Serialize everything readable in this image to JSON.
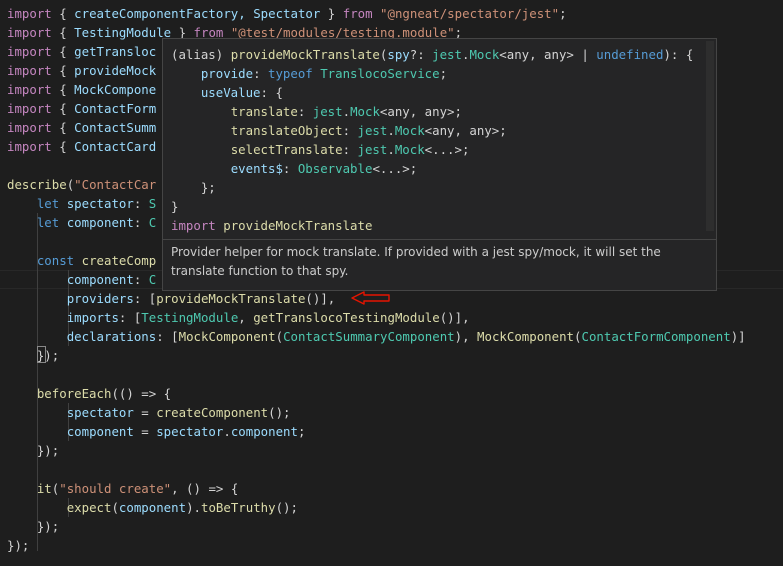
{
  "code": {
    "imports": [
      {
        "name": "createComponentFactory, Spectator",
        "module": "\"@ngneat/spectator/jest\""
      },
      {
        "name": "TestingModule",
        "module": "\"@test/modules/testing.module\""
      },
      {
        "name": "getTransloc",
        "module": ""
      },
      {
        "name": "provideMock",
        "module": ""
      },
      {
        "name": "MockCompone",
        "module": ""
      },
      {
        "name": "ContactForm",
        "module": ""
      },
      {
        "name": "ContactSumm",
        "module": ""
      },
      {
        "name": "ContactCard",
        "module": ""
      }
    ],
    "kw_import": "import",
    "kw_from": "from",
    "brace_open": "{ ",
    "brace_close": " }",
    "semi": ";",
    "describe_fn": "describe",
    "describe_str": "\"ContactCar",
    "let_kw": "let",
    "const_kw": "const",
    "spectator_var": "spectator",
    "spectator_type": "S",
    "component_var": "component",
    "component_type": "C",
    "create_var": "createComp",
    "component_key": "component",
    "component_val": "C",
    "providers_line": {
      "key": "providers",
      "open": ": [",
      "fn": "provideMockTranslate",
      "close": "()],"
    },
    "imports_line": {
      "key": "imports",
      "open": ": [",
      "mod": "TestingModule",
      "comma": ", ",
      "fn": "getTranslocoTestingModule",
      "close": "()],"
    },
    "declarations_line": {
      "key": "declarations",
      "open": ": [",
      "mc1": "MockComponent",
      "t1": "ContactSummaryComponent",
      "mid": "), ",
      "mc2": "MockComponent",
      "t2": "ContactFormComponent",
      "close": ")]"
    },
    "close_paren": "});",
    "before_each": "beforeEach",
    "arrow_open": "(() => {",
    "assign1_lhs": "spectator",
    "assign1_rhs": "createComponent",
    "assign2_lhs": "component",
    "assign2_obj": "spectator",
    "assign2_prop": "component",
    "close_brace": "});",
    "it_fn": "it",
    "it_str": "\"should create\"",
    "it_rest": ", () => {",
    "expect_fn": "expect",
    "expect_arg": "component",
    "to_be": "toBeTruthy",
    "final_close": "});"
  },
  "hover": {
    "sig_alias": "(alias) ",
    "sig_fn": "provideMockTranslate",
    "sig_param": "spy",
    "sig_opt": "?: ",
    "sig_jest": "jest",
    "sig_mock": "Mock",
    "sig_any": "<any, any>",
    "sig_pipe": " | ",
    "sig_undef": "undefined",
    "sig_end": "): {",
    "provide_key": "provide",
    "typeof_kw": "typeof",
    "service": "TranslocoService",
    "usevalue_key": "useValue",
    "translate_key": "translate",
    "translate_obj_key": "translateObject",
    "select_key": "selectTranslate",
    "events_key": "events$",
    "observable": "Observable",
    "ellipsis_generic": "<...>",
    "import_kw": "import",
    "import_name": "provideMockTranslate",
    "doc_text": "Provider helper for mock translate. If provided with a jest spy/mock, it will set the translate function to that spy."
  },
  "colors": {
    "background": "#1e1e1e",
    "keyword": "#c586c0",
    "function": "#dcdcaa",
    "variable": "#9cdcfe",
    "type": "#4ec9b0",
    "string": "#ce9178",
    "arrow_annotation": "#e51400"
  }
}
